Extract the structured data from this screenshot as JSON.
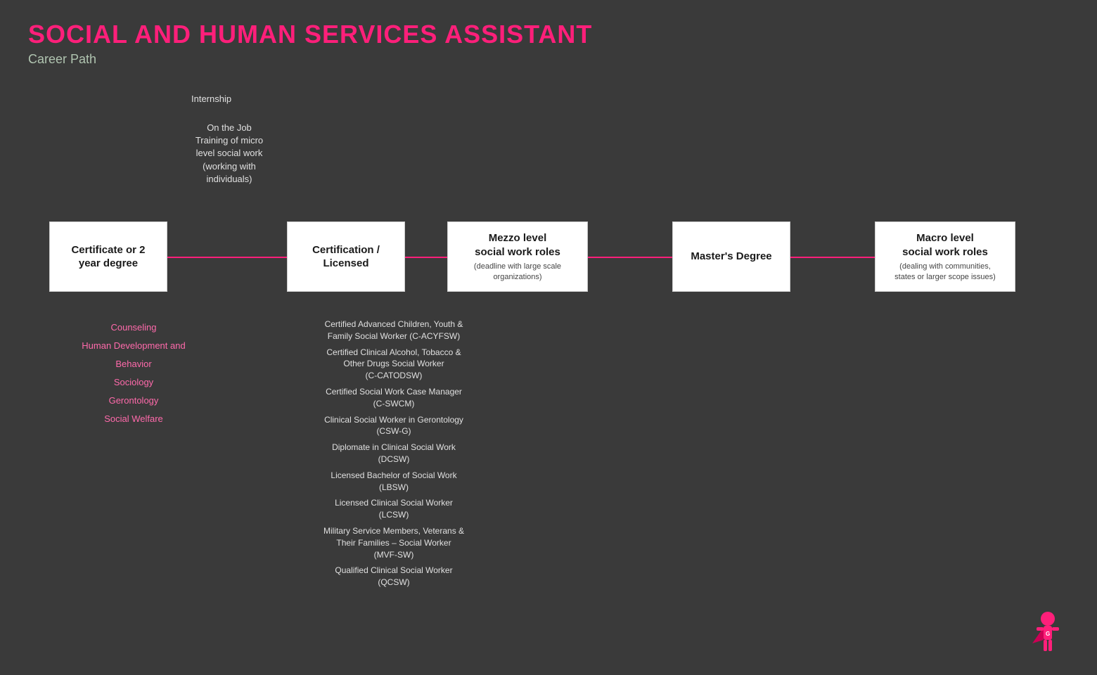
{
  "header": {
    "title": "SOCIAL AND HUMAN SERVICES ASSISTANT",
    "subtitle": "Career Path"
  },
  "labels": {
    "internship": "Internship",
    "ojt": "On the Job Training of micro level social work (working with individuals)"
  },
  "boxes": [
    {
      "id": "box1",
      "title": "Certificate or 2 year degree",
      "subtitle": ""
    },
    {
      "id": "box2",
      "title": "Certification / Licensed",
      "subtitle": ""
    },
    {
      "id": "box3",
      "title": "Mezzo level social work roles",
      "subtitle": "(deadline with large scale organizations)"
    },
    {
      "id": "box4",
      "title": "Master's Degree",
      "subtitle": ""
    },
    {
      "id": "box5",
      "title": "Macro level social work roles",
      "subtitle": "(dealing with communities, states or larger scope issues)"
    }
  ],
  "cert2_items": [
    "Counseling",
    "Human Development and Behavior",
    "Sociology",
    "Gerontology",
    "Social Welfare"
  ],
  "certlist_items": [
    "Certified Advanced Children, Youth &\nFamily Social Worker (C-ACYFSW)",
    "Certified Clinical Alcohol, Tobacco &\nOther Drugs Social Worker\n(C-CATODSW)",
    "Certified Social Work Case Manager\n(C-SWCM)",
    "Clinical Social Worker in Gerontology\n(CSW-G)",
    "Diplomate in Clinical Social Work\n(DCSW)",
    "Licensed Bachelor of Social Work\n(LBSW)",
    "Licensed Clinical Social Worker\n(LCSW)",
    "Military Service Members, Veterans &\nTheir Families – Social Worker\n(MVF-SW)",
    "Qualified Clinical Social Worker\n(QCSW)"
  ]
}
